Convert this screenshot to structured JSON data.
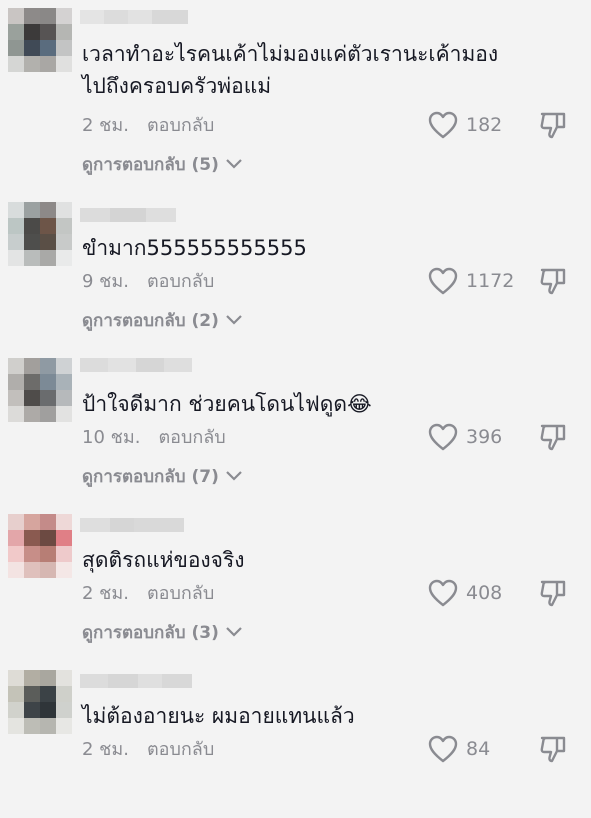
{
  "comments": [
    {
      "text": "เวลาทำอะไรคนเค้าไม่มองแค่ตัวเรานะเค้ามองไปถึงครอบครัวพ่อแม่",
      "time": "2 ชม.",
      "reply_label": "ตอบกลับ",
      "likes": "182",
      "view_replies": "ดูการตอบกลับ (5)"
    },
    {
      "text": "ขำมาก555555555555",
      "time": "9 ชม.",
      "reply_label": "ตอบกลับ",
      "likes": "1172",
      "view_replies": "ดูการตอบกลับ (2)"
    },
    {
      "text": "ป้าใจดีมาก ช่วยคนโดนไฟดูด😂",
      "time": "10 ชม.",
      "reply_label": "ตอบกลับ",
      "likes": "396",
      "view_replies": "ดูการตอบกลับ (7)"
    },
    {
      "text": "สุดติรถแห่ของจริง",
      "time": "2 ชม.",
      "reply_label": "ตอบกลับ",
      "likes": "408",
      "view_replies": "ดูการตอบกลับ (3)"
    },
    {
      "text": "ไม่ต้องอายนะ ผมอายแทนแล้ว",
      "time": "2 ชม.",
      "reply_label": "ตอบกลับ",
      "likes": "84",
      "view_replies": ""
    }
  ],
  "colors": {
    "text": "#161823",
    "secondary": "#8a8b91",
    "background": "#f3f3f3"
  }
}
